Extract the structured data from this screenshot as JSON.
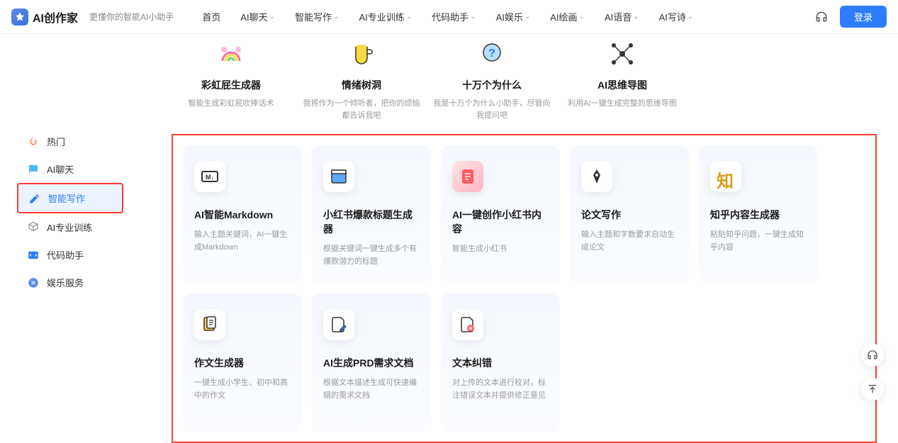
{
  "header": {
    "logo": "AI创作家",
    "tagline": "更懂你的智能AI小助手",
    "nav": [
      "首页",
      "AI聊天",
      "智能写作",
      "AI专业训练",
      "代码助手",
      "AI娱乐",
      "AI绘画",
      "AI语音",
      "AI写诗"
    ],
    "nav_has_chevron": [
      false,
      true,
      true,
      true,
      true,
      true,
      true,
      true,
      true
    ],
    "login": "登录"
  },
  "sidebar": {
    "items": [
      {
        "icon": "flame",
        "label": "热门",
        "color": "#ff6b35"
      },
      {
        "icon": "chat",
        "label": "AI聊天",
        "color": "#4db8ff"
      },
      {
        "icon": "edit",
        "label": "智能写作",
        "color": "#2f7cff",
        "active": true
      },
      {
        "icon": "cube",
        "label": "AI专业训练",
        "color": "#888"
      },
      {
        "icon": "code",
        "label": "代码助手",
        "color": "#2f7cff"
      },
      {
        "icon": "game",
        "label": "娱乐服务",
        "color": "#5b8def"
      }
    ]
  },
  "top_cards": [
    {
      "icon": "rainbow",
      "title": "彩虹屁生成器",
      "desc": "智能生成彩虹屁吹捧话术"
    },
    {
      "icon": "cup",
      "title": "情绪树洞",
      "desc": "我将作为一个倾听者，把你的烦恼都告诉我吧"
    },
    {
      "icon": "question",
      "title": "十万个为什么",
      "desc": "我是十万个为什么小助手，尽管向我提问吧"
    },
    {
      "icon": "mindmap",
      "title": "AI思维导图",
      "desc": "利用AI一键生成完整的思维导图"
    }
  ],
  "cards": [
    {
      "icon": "markdown",
      "title": "AI智能Markdown",
      "desc": "输入主题关键词，AI一键生成Markdown"
    },
    {
      "icon": "window",
      "title": "小红书爆款标题生成器",
      "desc": "根据关键词一键生成多个有爆款潜力的标题"
    },
    {
      "icon": "note-red",
      "title": "AI一键创作小红书内容",
      "desc": "智能生成小红书"
    },
    {
      "icon": "pen",
      "title": "论文写作",
      "desc": "输入主题和字数要求自动生成论文"
    },
    {
      "icon": "zhi",
      "title": "知乎内容生成器",
      "desc": "粘贴知乎问题，一键生成知乎内容"
    },
    {
      "icon": "doc-orange",
      "title": "作文生成器",
      "desc": "一键生成小学生、初中和高中的作文"
    },
    {
      "icon": "doc-edit",
      "title": "AI生成PRD需求文档",
      "desc": "根据文本描述生成可快速编辑的需求文档"
    },
    {
      "icon": "doc-error",
      "title": "文本纠错",
      "desc": "对上传的文本进行校对，标注错误文本并提供修正意见"
    }
  ]
}
